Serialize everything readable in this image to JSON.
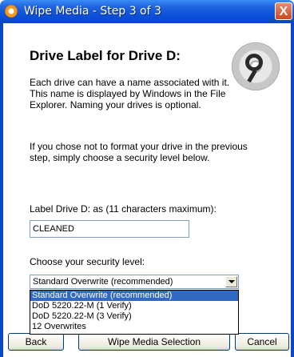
{
  "window": {
    "title": "Wipe Media - Step 3 of 3",
    "close_label": "X"
  },
  "heading": "Drive Label for Drive D:",
  "paragraphs": {
    "intro": "Each drive can have a name associated with it.  This name is displayed by Windows in the File Explorer.  Naming your drives is optional.",
    "format": "If you chose not to format your drive in the previous step, simply choose a security level below."
  },
  "label_field": {
    "prompt": "Label Drive D: as (11 characters maximum):",
    "value": "CLEANED"
  },
  "security": {
    "prompt": "Choose your security level:",
    "selected": "Standard Overwrite (recommended)",
    "options": [
      "Standard Overwrite (recommended)",
      "DoD 5220.22-M (1 Verify)",
      "DoD 5220.22-M (3 Verify)",
      "12 Overwrites"
    ]
  },
  "buttons": {
    "back": "Back",
    "wipe": "Wipe Media Selection",
    "cancel": "Cancel"
  },
  "colors": {
    "titlebar": "#0a4fd6",
    "selection": "#316ac5",
    "close": "#d2451f"
  }
}
